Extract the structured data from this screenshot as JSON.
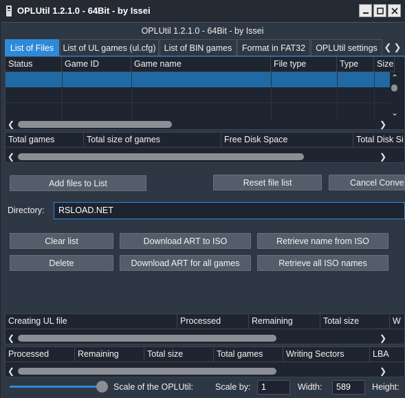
{
  "window": {
    "title": "OPLUtil 1.2.1.0 - 64Bit - by Issei",
    "header": "OPLUtil 1.2.1.0 - 64Bit - by Issei"
  },
  "tabs": [
    "List of Files",
    "List of UL games (ul.cfg)",
    "List of BIN games",
    "Format in FAT32",
    "OPLUtil settings"
  ],
  "files_table": {
    "columns": [
      "Status",
      "Game ID",
      "Game name",
      "File type",
      "Type",
      "Size"
    ]
  },
  "totals_table": {
    "columns": [
      "Total games",
      "Total size of games",
      "Free Disk Space",
      "Total Disk Si"
    ]
  },
  "buttons": {
    "add_files": "Add files to List",
    "reset_file_list": "Reset file list",
    "cancel_convert": "Cancel Conver",
    "clear_list": "Clear list",
    "download_art_iso": "Download ART to ISO",
    "retrieve_name_iso": "Retrieve name from ISO",
    "delete": "Delete",
    "download_art_all": "Download ART for all games",
    "retrieve_all_iso": "Retrieve all ISO names"
  },
  "directory": {
    "label": "Directory:",
    "value": "RSLOAD.NET"
  },
  "ul_table": {
    "columns": [
      "Creating UL file",
      "Processed",
      "Remaining",
      "Total size",
      "W"
    ]
  },
  "progress_table": {
    "columns": [
      "Processed",
      "Remaining",
      "Total size",
      "Total games",
      "Writing Sectors",
      "LBA"
    ]
  },
  "bottom": {
    "scale_label": "Scale of the OPLUtil:",
    "scale_by_label": "Scale by:",
    "scale_by_value": "1",
    "width_label": "Width:",
    "width_value": "589",
    "height_label": "Height:",
    "scale_fraction": 1.0
  }
}
